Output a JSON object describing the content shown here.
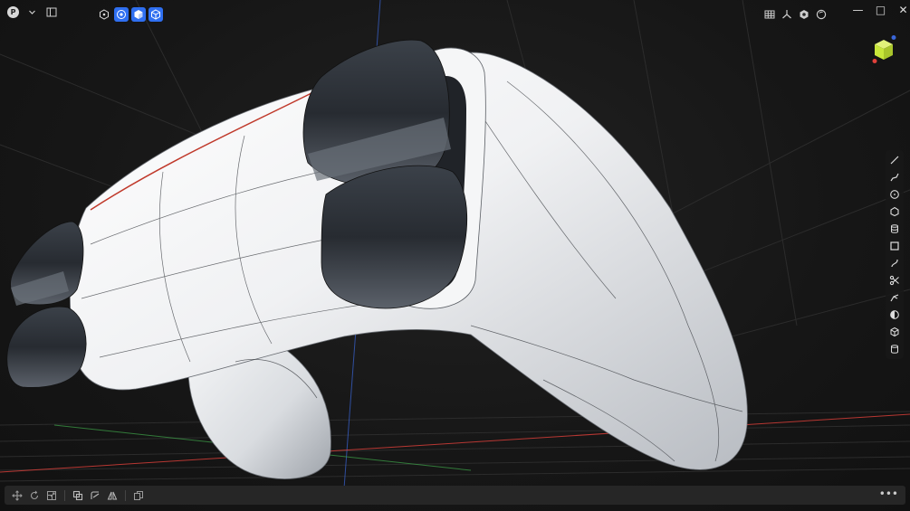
{
  "app": {
    "avatar_letter": "P"
  },
  "icons": {
    "dropdown": "chevron-down-icon",
    "sidebar": "sidebar-toggle-icon",
    "mode": [
      "hexagon-icon",
      "solid-shaded-icon",
      "cube-solid-icon",
      "cube-wire-icon"
    ],
    "view": [
      "grid-icon",
      "axis-icon",
      "render-icon",
      "material-sphere-icon"
    ],
    "window": [
      "minimize-icon",
      "maximize-icon",
      "close-icon"
    ],
    "right_tools": [
      "line-icon",
      "polyline-icon",
      "circle-icon",
      "polygon-icon",
      "cylinder-icon",
      "rectangle-icon",
      "curve-icon",
      "scissors-icon",
      "extend-icon",
      "shell-icon",
      "box-icon",
      "solid-cylinder-icon"
    ],
    "bottom_tools": [
      "move-icon",
      "rotate-icon",
      "scale-icon",
      "boolean-icon",
      "transform-icon",
      "mirror-icon",
      "copy-icon"
    ],
    "more": "more-icon"
  },
  "labels": {
    "window_min": "—",
    "window_max": "□",
    "window_close": "✕",
    "more": "•••"
  },
  "colors": {
    "accent": "#2f6ff0",
    "axis_x": "#e0403a",
    "axis_y": "#3fa64a",
    "axis_z": "#3a66d8",
    "nav_cube": "#c8e63a"
  }
}
